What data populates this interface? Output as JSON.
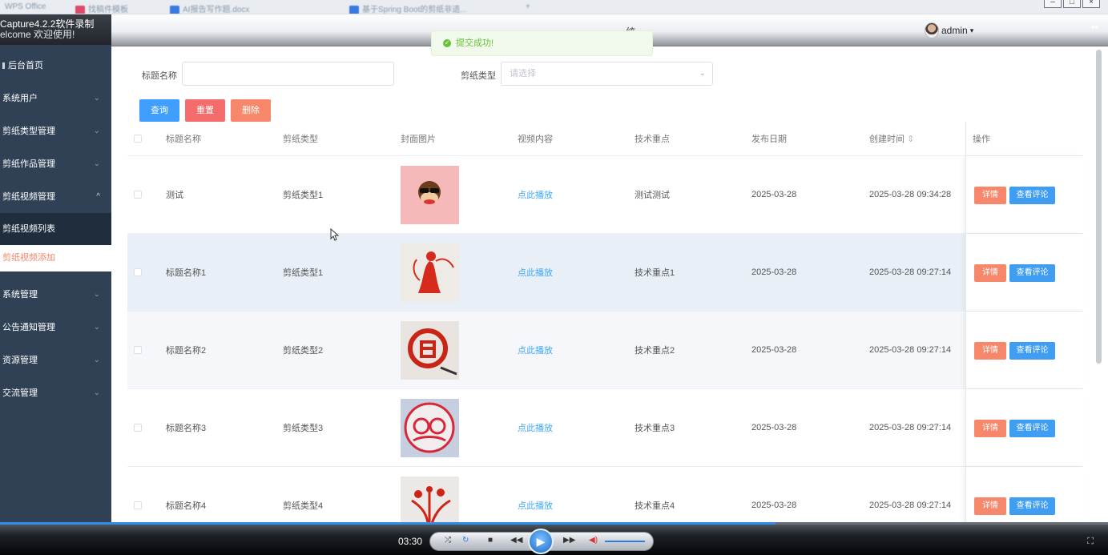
{
  "os": {
    "tabs": [
      "WPS Office",
      "找稿件模板",
      "AI报告写作题.docx",
      "基于Spring Boot的剪纸非遗..."
    ],
    "new_tab": "+"
  },
  "sidebar": {
    "brand_line1": "Capture4.2.2软件录制",
    "brand_line2": "elcome 欢迎使用!",
    "items": [
      {
        "label": "后台首页",
        "arrow": ""
      },
      {
        "label": "系统用户",
        "arrow": "⌄"
      },
      {
        "label": "剪纸类型管理",
        "arrow": "⌄"
      },
      {
        "label": "剪纸作品管理",
        "arrow": "⌄"
      },
      {
        "label": "剪纸视频管理",
        "arrow": "^"
      },
      {
        "label": "剪纸视频列表",
        "arrow": ""
      },
      {
        "label": "剪纸视频添加",
        "arrow": ""
      },
      {
        "label": "系统管理",
        "arrow": "⌄"
      },
      {
        "label": "公告通知管理",
        "arrow": "⌄"
      },
      {
        "label": "资源管理",
        "arrow": "⌄"
      },
      {
        "label": "交流管理",
        "arrow": "⌄"
      }
    ]
  },
  "header": {
    "title": "统",
    "user": "admin",
    "user_caret": "▾"
  },
  "toast": {
    "text": "提交成功!"
  },
  "filters": {
    "title_label": "标题名称",
    "title_value": "",
    "type_label": "剪纸类型",
    "type_placeholder": "请选择"
  },
  "buttons": {
    "query": "查询",
    "reset": "重置",
    "delete": "删除"
  },
  "table": {
    "headers": [
      "标题名称",
      "剪纸类型",
      "封面图片",
      "视频内容",
      "技术重点",
      "发布日期",
      "创建时间",
      "操作"
    ],
    "sort_icon": "⇕",
    "rows": [
      {
        "title": "测试",
        "type": "剪纸类型1",
        "video": "点此播放",
        "focus": "测试测试",
        "date": "2025-03-28",
        "created": "2025-03-28 09:34:28",
        "thumb": "monkey"
      },
      {
        "title": "标题名称1",
        "type": "剪纸类型1",
        "video": "点此播放",
        "focus": "技术重点1",
        "date": "2025-03-28",
        "created": "2025-03-28 09:27:14",
        "thumb": "lady"
      },
      {
        "title": "标题名称2",
        "type": "剪纸类型2",
        "video": "点此播放",
        "focus": "技术重点2",
        "date": "2025-03-28",
        "created": "2025-03-28 09:27:14",
        "thumb": "fu"
      },
      {
        "title": "标题名称3",
        "type": "剪纸类型3",
        "video": "点此播放",
        "focus": "技术重点3",
        "date": "2025-03-28",
        "created": "2025-03-28 09:27:14",
        "thumb": "panda"
      },
      {
        "title": "标题名称4",
        "type": "剪纸类型4",
        "video": "点此播放",
        "focus": "技术重点4",
        "date": "2025-03-28",
        "created": "2025-03-28 09:27:14",
        "thumb": "orchid"
      }
    ],
    "detail_label": "详情",
    "comment_label": "查看评论"
  },
  "player": {
    "time": "03:30"
  },
  "colors": {
    "sidebar": "#304156",
    "primary": "#409eff",
    "danger": "#f56c6c",
    "detail": "#f7876a",
    "comment": "#3f9df2",
    "link": "#3fa8f4",
    "success": "#67c23a"
  }
}
